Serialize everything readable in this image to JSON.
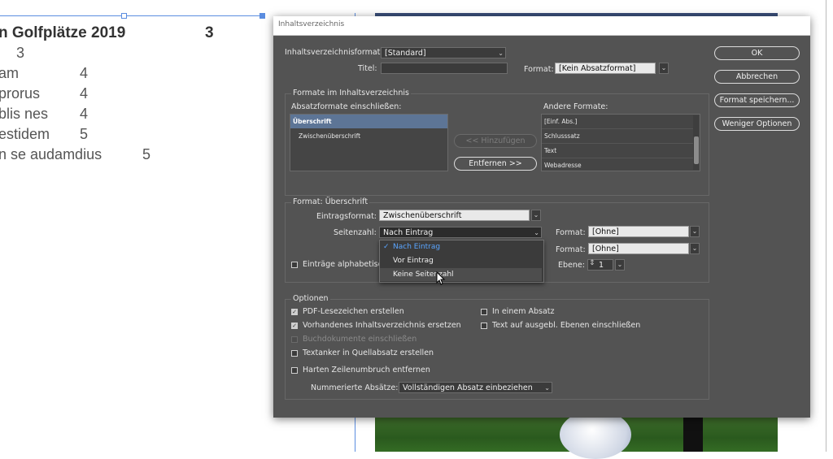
{
  "document": {
    "title": "n Golfplätze 2019",
    "title_page": "3",
    "lines": [
      {
        "text": "3",
        "page": ""
      },
      {
        "text": "am",
        "page": "4"
      },
      {
        "text": "prorus",
        "page": "4"
      },
      {
        "text": "blis nes",
        "page": "4"
      },
      {
        "text": "estidem",
        "page": "5"
      },
      {
        "text": "n se audamdius",
        "page": "5"
      }
    ]
  },
  "dialog": {
    "title": "Inhaltsverzeichnis",
    "toc_format_label": "Inhaltsverzeichnisformat:",
    "toc_format_value": "[Standard]",
    "title_label": "Titel:",
    "title_value": "",
    "format_label": "Format:",
    "format_value": "[Kein Absatzformat]",
    "buttons": {
      "ok": "OK",
      "cancel": "Abbrechen",
      "save_format": "Format speichern...",
      "fewer_options": "Weniger Optionen"
    },
    "styles_group": {
      "label": "Formate im Inhaltsverzeichnis",
      "include_label": "Absatzformate einschließen:",
      "include_items": [
        "Überschrift",
        "Zwischenüberschrift"
      ],
      "add_button": "<< Hinzufügen",
      "remove_button": "Entfernen >>",
      "other_label": "Andere Formate:",
      "other_items": [
        "[Einf. Abs.]",
        "Schlusssatz",
        "Text",
        "Webadresse"
      ]
    },
    "style_group": {
      "label": "Format: Überschrift",
      "entry_format_label": "Eintragsformat:",
      "entry_format_value": "Zwischenüberschrift",
      "page_number_label": "Seitenzahl:",
      "page_number_value": "Nach Eintrag",
      "page_number_options": [
        "Nach Eintrag",
        "Vor Eintrag",
        "Keine Seitenzahl"
      ],
      "page_format_label": "Format:",
      "page_format_value": "[Ohne]",
      "between_format_label": "Format:",
      "between_format_value": "[Ohne]",
      "sort_label": "Einträge alphabetisc",
      "level_label": "Ebene:",
      "level_value": "1"
    },
    "options_group": {
      "label": "Optionen",
      "pdf_bookmarks": "PDF-Lesezeichen erstellen",
      "replace_toc": "Vorhandenes Inhaltsverzeichnis ersetzen",
      "book_docs": "Buchdokumente einschließen",
      "text_anchor": "Textanker in Quellabsatz erstellen",
      "remove_breaks": "Harten Zeilenumbruch entfernen",
      "run_in": "In einem Absatz",
      "hidden_layers": "Text auf ausgebl. Ebenen einschließen",
      "numbered_label": "Nummerierte Absätze:",
      "numbered_value": "Vollständigen Absatz einbeziehen"
    }
  },
  "colors": {
    "dialog_bg": "#535353",
    "selection": "#5d7596",
    "menu_selected": "#5aa5ff",
    "guide": "#5b8de0"
  }
}
